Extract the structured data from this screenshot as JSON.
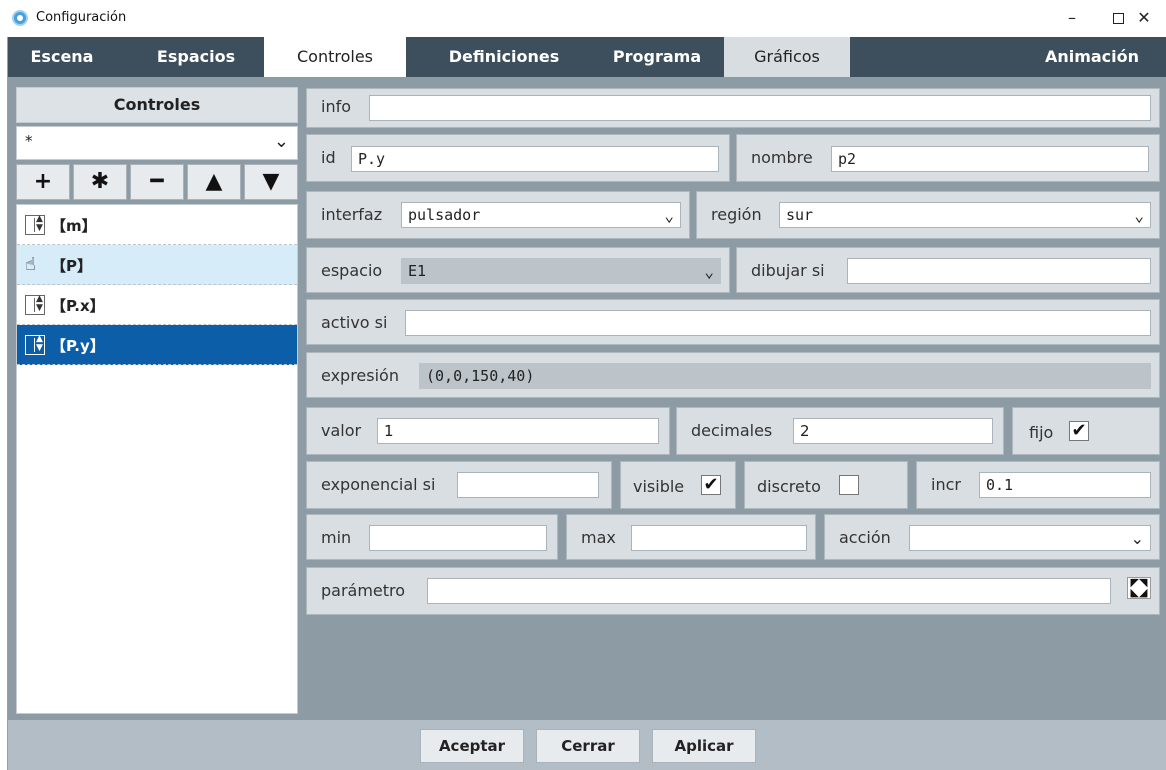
{
  "window": {
    "title": "Configuración",
    "min": "–",
    "close": "✕"
  },
  "tabs": [
    "Escena",
    "Espacios",
    "Controles",
    "Definiciones",
    "Programa",
    "Gráficos",
    "Animación"
  ],
  "active_tab": "Controles",
  "left": {
    "header": "Controles",
    "filter_value": "*",
    "tools": [
      "+",
      "✱",
      "━",
      "▲",
      "▼"
    ],
    "items": [
      {
        "label": "【m】",
        "icon": "spinner-icon"
      },
      {
        "label": "【P】",
        "icon": "hand-pointer-icon"
      },
      {
        "label": "【P.x】",
        "icon": "spinner-icon"
      },
      {
        "label": "【P.y】",
        "icon": "spinner-icon"
      }
    ],
    "selected_index": 3
  },
  "form": {
    "info": {
      "label": "info",
      "value": ""
    },
    "id": {
      "label": "id",
      "value": "P.y"
    },
    "nombre": {
      "label": "nombre",
      "value": "p2"
    },
    "interfaz": {
      "label": "interfaz",
      "value": "pulsador"
    },
    "region": {
      "label": "región",
      "value": "sur"
    },
    "espacio": {
      "label": "espacio",
      "value": "E1"
    },
    "dibujar_si": {
      "label": "dibujar si",
      "value": ""
    },
    "activo_si": {
      "label": "activo si",
      "value": ""
    },
    "expresion": {
      "label": "expresión",
      "value": "(0,0,150,40)"
    },
    "valor": {
      "label": "valor",
      "value": "1"
    },
    "decimales": {
      "label": "decimales",
      "value": "2"
    },
    "fijo": {
      "label": "fijo",
      "checked": true
    },
    "exponencial_si": {
      "label": "exponencial si",
      "value": ""
    },
    "visible": {
      "label": "visible",
      "checked": true
    },
    "discreto": {
      "label": "discreto",
      "checked": false
    },
    "incr": {
      "label": "incr",
      "value": "0.1"
    },
    "min": {
      "label": "min",
      "value": ""
    },
    "max": {
      "label": "max",
      "value": ""
    },
    "accion": {
      "label": "acción",
      "value": ""
    },
    "parametro": {
      "label": "parámetro",
      "value": ""
    }
  },
  "footer": {
    "accept": "Aceptar",
    "close": "Cerrar",
    "apply": "Aplicar"
  },
  "colors": {
    "tabbar": "#3d4e5c",
    "panel": "#8d9ba5",
    "selected": "#0b5ea7",
    "field_box": "#d9dee2"
  }
}
